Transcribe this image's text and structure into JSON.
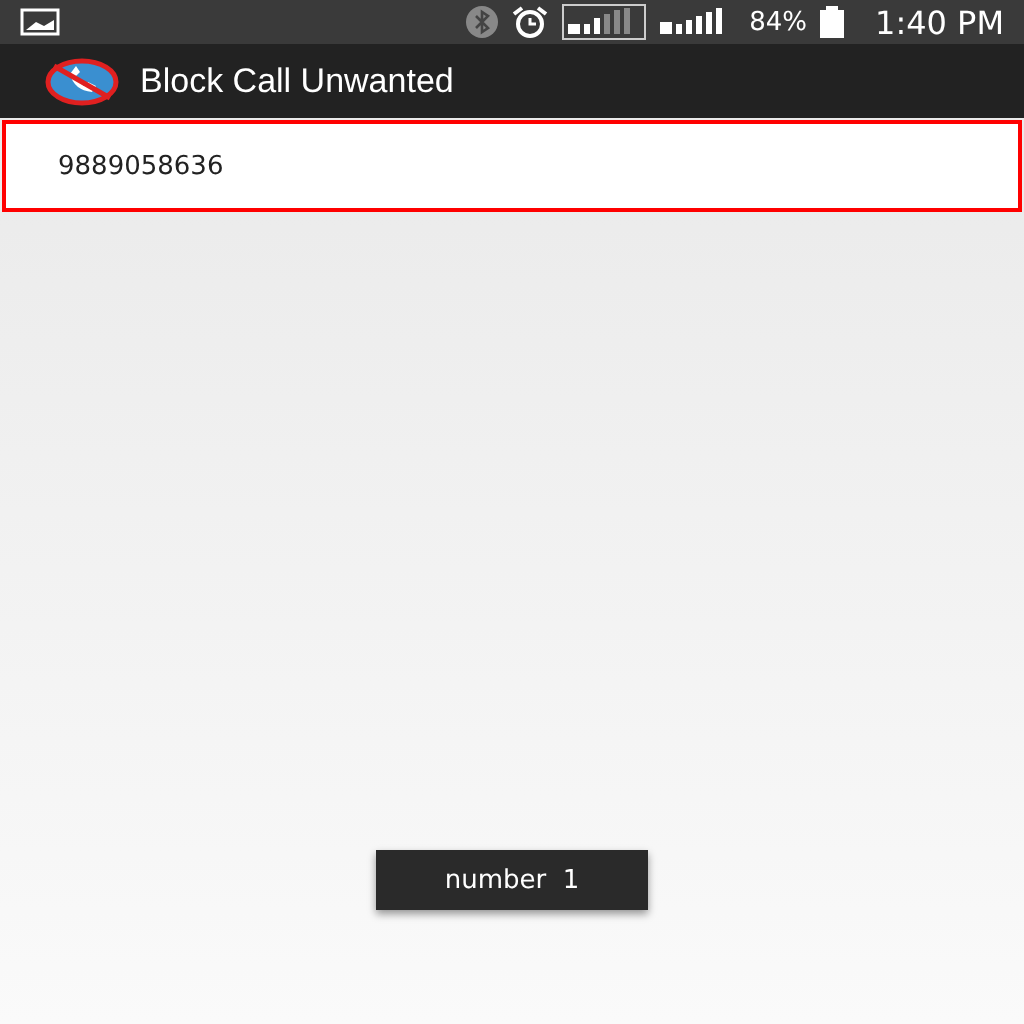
{
  "status_bar": {
    "battery": "84%",
    "time": "1:40 PM"
  },
  "action_bar": {
    "title": "Block Call Unwanted"
  },
  "list": [
    {
      "number": "9889058636",
      "selected": true
    }
  ],
  "toast": "number  1"
}
